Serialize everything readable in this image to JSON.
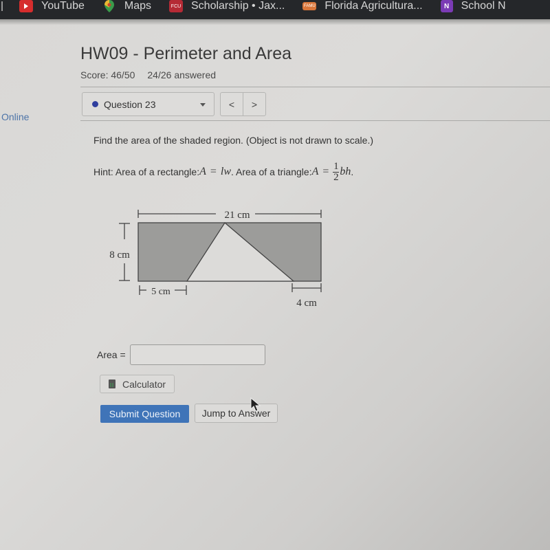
{
  "bookmarks": [
    {
      "label": "YouTube",
      "icon": "youtube-icon"
    },
    {
      "label": "Maps",
      "icon": "maps-icon"
    },
    {
      "label": "Scholarship • Jax...",
      "icon": "fcu-icon",
      "icon_text": "FCU"
    },
    {
      "label": "Florida Agricultura...",
      "icon": "famu-icon",
      "icon_text": "FAMU"
    },
    {
      "label": "School N",
      "icon": "onenote-icon",
      "icon_text": "N"
    }
  ],
  "sidebar": {
    "online_label": "Online"
  },
  "header": {
    "title": "HW09 - Perimeter and Area",
    "score": "Score: 46/50",
    "answered": "24/26 answered"
  },
  "question_nav": {
    "selected": "Question 23",
    "status_color": "#2f3e9e",
    "prev_label": "<",
    "next_label": ">"
  },
  "question": {
    "prompt": "Find the area of the shaded region. (Object is not drawn to scale.)",
    "hint_prefix": "Hint: Area of a rectangle: ",
    "hint_rect_lhs": "A",
    "hint_eq": "=",
    "hint_rect_rhs": "lw",
    "hint_middle": ". Area of a triangle: ",
    "hint_tri_lhs": "A",
    "hint_frac_num": "1",
    "hint_frac_den": "2",
    "hint_tri_rhs": "bh",
    "hint_end": "."
  },
  "figure": {
    "width_label": "21 cm",
    "height_label": "8 cm",
    "left_gap_label": "5 cm",
    "right_gap_label": "4 cm",
    "shaded_color": "#9c9c9a",
    "triangle_color": "#dcdbd9"
  },
  "answer": {
    "label": "Area =",
    "value": "",
    "placeholder": ""
  },
  "buttons": {
    "calculator": "Calculator",
    "submit": "Submit Question",
    "jump": "Jump to Answer"
  }
}
